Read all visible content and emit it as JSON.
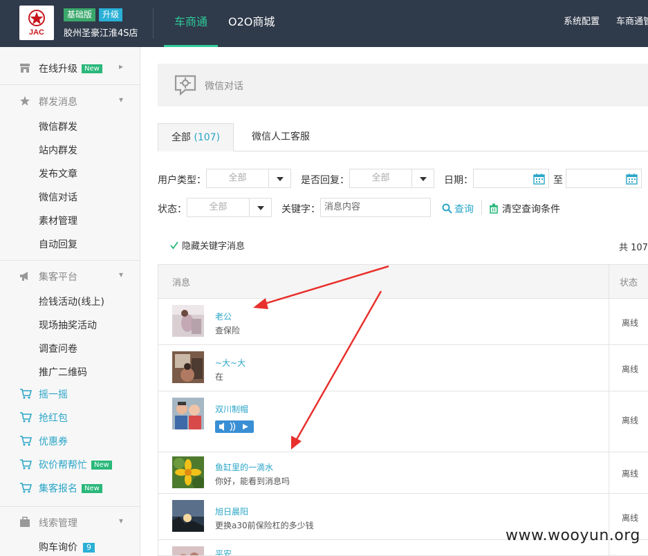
{
  "header": {
    "logo_text": "JAC",
    "badge_basic": "基础版",
    "badge_upgrade": "升级",
    "shop_name": "胶州圣豪江淮4S店",
    "nav": [
      "车商通",
      "O2O商城"
    ],
    "nav_active": "车商通",
    "right_links": [
      "系统配置",
      "车商通管"
    ]
  },
  "sidebar": {
    "online_upgrade": "在线升级",
    "new_tag": "New",
    "group_mass": "群发消息",
    "mass_items": [
      "微信群发",
      "站内群发",
      "发布文章",
      "微信对话",
      "素材管理",
      "自动回复"
    ],
    "group_collect": "集客平台",
    "collect_items": [
      "捡钱活动(线上)",
      "现场抽奖活动",
      "调查问卷",
      "推广二维码"
    ],
    "cart_items": [
      "摇一摇",
      "抢红包",
      "优惠券",
      "砍价帮帮忙",
      "集客报名"
    ],
    "group_leads": "线索管理",
    "lead_items": [
      "购车询价"
    ],
    "lead_count": "9"
  },
  "page": {
    "title": "微信对话",
    "tab_all": "全部",
    "tab_all_count": "(107)",
    "tab_service": "微信人工客服"
  },
  "filters": {
    "user_type_label": "用户类型：",
    "user_type_value": "全部",
    "replied_label": "是否回复：",
    "replied_value": "全部",
    "date_label": "日期：",
    "date_to": "至",
    "status_label": "状态：",
    "status_value": "全部",
    "keyword_label": "关键字：",
    "keyword_placeholder": "消息内容",
    "query_btn": "查询",
    "clear_btn": "清空查询条件",
    "hide_keyword": "隐藏关键字消息",
    "total_prefix": "共 107"
  },
  "table": {
    "col_message": "消息",
    "col_status": "状态",
    "rows": [
      {
        "name": "老公",
        "message": "查保险",
        "status": "离线"
      },
      {
        "name": "~大~大",
        "message": "在",
        "status": "离线"
      },
      {
        "name": "双川制帽",
        "message": "",
        "status": "离线"
      },
      {
        "name": "鱼缸里的一滴水",
        "message": "你好，能看到消息吗",
        "status": "离线"
      },
      {
        "name": "旭日晨阳",
        "message": "更换a30前保险杠的多少钱",
        "status": "离线"
      },
      {
        "name": "平安",
        "message": "",
        "status": ""
      }
    ]
  },
  "watermark": "www.wooyun.org",
  "colors": {
    "topbar": "#2f3a4a",
    "accent_green": "#2ecc9a",
    "link_blue": "#2aa5c7",
    "arrow_red": "#e8302c"
  }
}
